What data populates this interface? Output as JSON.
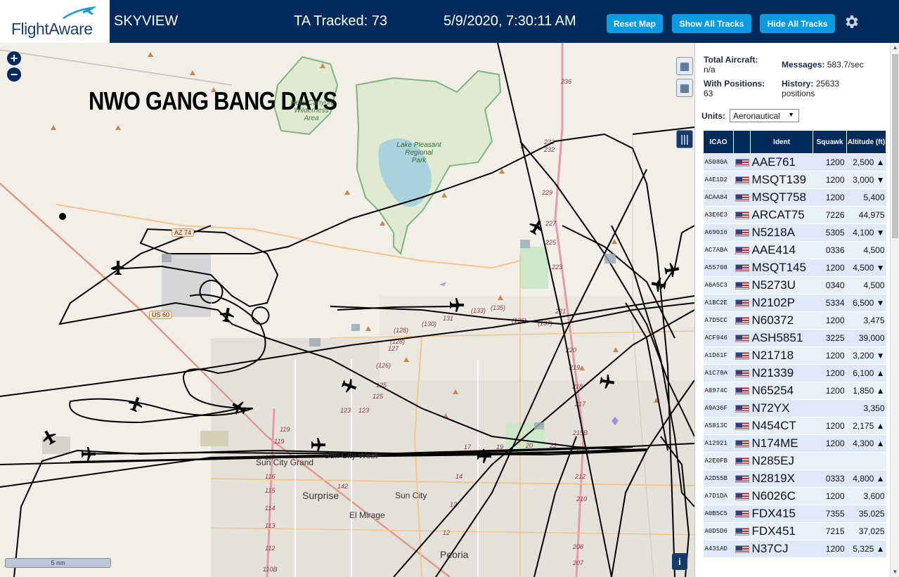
{
  "header": {
    "logo": "FlightAware",
    "app_name": "SKYVIEW",
    "tracked": "TA Tracked: 73",
    "datetime": "5/9/2020, 7:30:11 AM",
    "reset_label": "Reset Map",
    "show_label": "Show All Tracks",
    "hide_label": "Hide All Tracks"
  },
  "map": {
    "overlay_text": "NWO GANG BANG DAYS",
    "zoom_in": "+",
    "zoom_out": "−",
    "scale_label": "5 nm",
    "places": {
      "sun_city_grand": "Sun City Grand",
      "sun_city_west": "Sun City West",
      "surprise": "Surprise",
      "sun_city": "Sun City",
      "el_mirage": "El Mirage",
      "peoria": "Peoria"
    },
    "parks": {
      "lake_pleasant": "Lake Pleasant\nRegional\nPark",
      "wilderness": "Hells Canyon\nWilderness\nArea"
    },
    "shields": {
      "az74": "AZ 74",
      "us60": "US 60"
    }
  },
  "sidebar": {
    "total_aircraft_label": "Total Aircraft:",
    "total_aircraft_value": "n/a",
    "with_positions_label": "With Positions:",
    "with_positions_value": "63",
    "messages_label": "Messages:",
    "messages_value": "583.7/sec",
    "history_label": "History:",
    "history_value": "25633",
    "history_unit": "positions",
    "units_label": "Units:",
    "units_value": "Aeronautical",
    "columns": {
      "icao": "ICAO",
      "ident": "Ident",
      "squawk": "Squawk",
      "altitude": "Altitude (ft)"
    }
  },
  "aircraft": [
    {
      "icao": "A5080A",
      "ident": "AAE761",
      "squawk": "1200",
      "alt": "2,500 ▲"
    },
    {
      "icao": "A4E1D2",
      "ident": "MSQT139",
      "squawk": "1200",
      "alt": "3,000 ▼"
    },
    {
      "icao": "ACAA84",
      "ident": "MSQT758",
      "squawk": "1200",
      "alt": "5,400"
    },
    {
      "icao": "A3E6E3",
      "ident": "ARCAT75",
      "squawk": "7226",
      "alt": "44,975"
    },
    {
      "icao": "A69016",
      "ident": "N5218A",
      "squawk": "5305",
      "alt": "4,100 ▼"
    },
    {
      "icao": "AC7ABA",
      "ident": "AAE414",
      "squawk": "0336",
      "alt": "4,500"
    },
    {
      "icao": "A55708",
      "ident": "MSQT145",
      "squawk": "1200",
      "alt": "4,500 ▼"
    },
    {
      "icao": "A6A5C3",
      "ident": "N5273U",
      "squawk": "0340",
      "alt": "4,500"
    },
    {
      "icao": "A1BC2E",
      "ident": "N2102P",
      "squawk": "5334",
      "alt": "6,500 ▼"
    },
    {
      "icao": "A7D5CC",
      "ident": "N60372",
      "squawk": "1200",
      "alt": "3,475"
    },
    {
      "icao": "ACF946",
      "ident": "ASH5851",
      "squawk": "3225",
      "alt": "39,000"
    },
    {
      "icao": "A1D61F",
      "ident": "N21718",
      "squawk": "1200",
      "alt": "3,200 ▼"
    },
    {
      "icao": "A1C78A",
      "ident": "N21339",
      "squawk": "1200",
      "alt": "6,100 ▲"
    },
    {
      "icao": "A8974C",
      "ident": "N65254",
      "squawk": "1200",
      "alt": "1,850 ▲"
    },
    {
      "icao": "A9A36F",
      "ident": "N72YX",
      "squawk": "",
      "alt": "3,350"
    },
    {
      "icao": "A5813C",
      "ident": "N454CT",
      "squawk": "1200",
      "alt": "2,175 ▲"
    },
    {
      "icao": "A12921",
      "ident": "N174ME",
      "squawk": "1200",
      "alt": "4,300 ▲"
    },
    {
      "icao": "A2E0FB",
      "ident": "N285EJ",
      "squawk": "",
      "alt": ""
    },
    {
      "icao": "A2D55B",
      "ident": "N2819X",
      "squawk": "0333",
      "alt": "4,800 ▲"
    },
    {
      "icao": "A7D1DA",
      "ident": "N6026C",
      "squawk": "1200",
      "alt": "3,600"
    },
    {
      "icao": "A0B5C5",
      "ident": "FDX415",
      "squawk": "7355",
      "alt": "35,025"
    },
    {
      "icao": "A0D5D6",
      "ident": "FDX451",
      "squawk": "7215",
      "alt": "37,025"
    },
    {
      "icao": "A431AD",
      "ident": "N37CJ",
      "squawk": "1200",
      "alt": "5,325 ▲"
    }
  ]
}
